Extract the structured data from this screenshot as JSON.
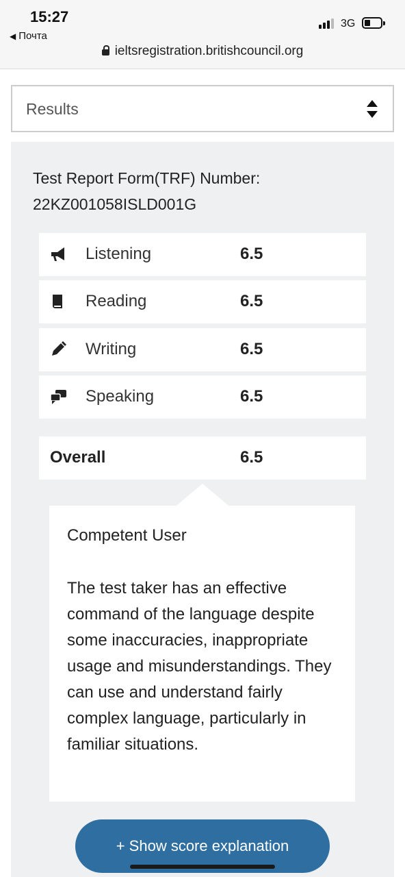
{
  "status_bar": {
    "time": "15:27",
    "back_label": "Почта",
    "network": "3G",
    "url": "ieltsregistration.britishcouncil.org"
  },
  "select": {
    "value": "Results"
  },
  "trf": {
    "label": "Test Report Form(TRF) Number:",
    "number": "22KZ001058ISLD001G"
  },
  "scores": [
    {
      "name": "Listening",
      "score": "6.5",
      "icon": "megaphone-icon"
    },
    {
      "name": "Reading",
      "score": "6.5",
      "icon": "book-icon"
    },
    {
      "name": "Writing",
      "score": "6.5",
      "icon": "pencil-icon"
    },
    {
      "name": "Speaking",
      "score": "6.5",
      "icon": "chat-bubbles-icon"
    }
  ],
  "overall": {
    "label": "Overall",
    "score": "6.5"
  },
  "description": {
    "level": "Competent User",
    "text": "The test taker has an effective command of the language despite some inaccuracies, inappropriate usage and misunderstandings. They can use and understand fairly complex language, particularly in familiar situations."
  },
  "button": {
    "label": "+ Show score explanation"
  },
  "colors": {
    "button": "#2f6ea1",
    "panel": "#eef0f2"
  }
}
